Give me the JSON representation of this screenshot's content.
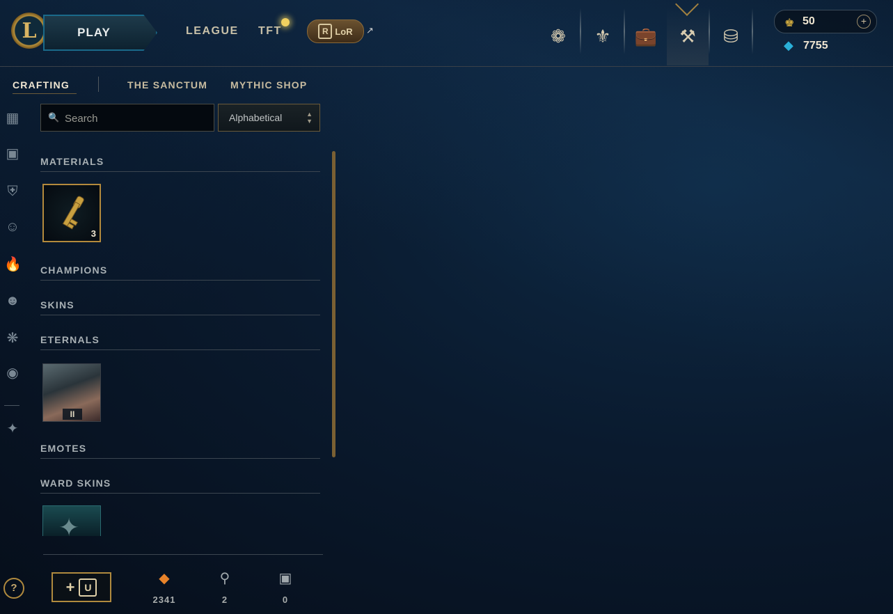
{
  "topbar": {
    "play_label": "PLAY",
    "nav": [
      "LEAGUE",
      "TFT"
    ],
    "lor_label": "LoR",
    "icons": [
      "profile-lotus-icon",
      "honor-icon",
      "collection-bag-icon",
      "loot-crafting-icon",
      "store-coins-icon"
    ],
    "active_icon": "loot-crafting-icon",
    "riot_points": "50",
    "blue_essence": "7755"
  },
  "subnav": {
    "tabs": [
      "CRAFTING",
      "THE SANCTUM",
      "MYTHIC SHOP"
    ],
    "active": "CRAFTING"
  },
  "rail": {
    "icons": [
      "all-grid-icon",
      "chest-icon",
      "champion-helmet-icon",
      "skin-mask-icon",
      "eternals-flame-icon",
      "emote-face-icon",
      "ward-icon",
      "icons-profile-icon",
      "other-icon"
    ]
  },
  "search": {
    "placeholder": "Search"
  },
  "sort": {
    "value": "Alphabetical"
  },
  "sections": {
    "materials": "MATERIALS",
    "champions": "CHAMPIONS",
    "skins": "SKINS",
    "eternals": "ETERNALS",
    "emotes": "EMOTES",
    "ward_skins": "WARD SKINS"
  },
  "tiles": {
    "key_count": "3",
    "eternal_tier": "II"
  },
  "footer": {
    "add_label": "+",
    "orange_essence": "2341",
    "keys": "2",
    "chests": "0"
  },
  "help_label": "?",
  "colors": {
    "gold": "#c8aa6e",
    "blue_essence": "#2ab0d8",
    "orange_essence": "#e8832a"
  }
}
